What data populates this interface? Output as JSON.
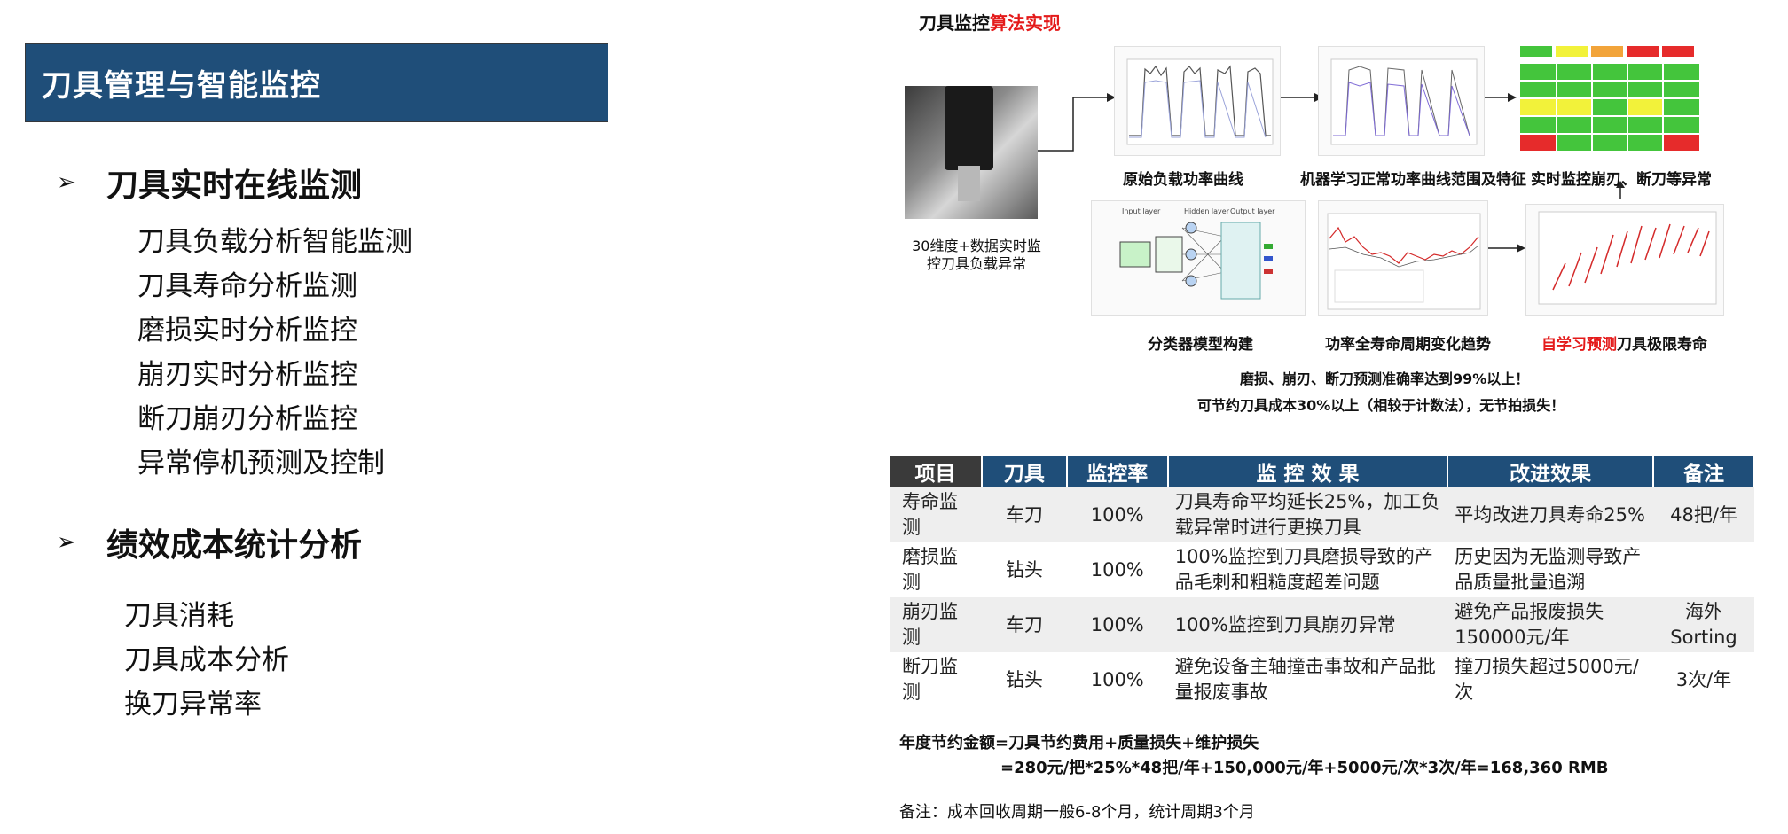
{
  "left": {
    "title": "刀具管理与智能监控",
    "section1": {
      "heading": "刀具实时在线监测",
      "items": [
        "刀具负载分析智能监测",
        "刀具寿命分析监测",
        "磨损实时分析监控",
        "崩刃实时分析监控",
        "断刀崩刃分析监控",
        "异常停机预测及控制"
      ]
    },
    "section2": {
      "heading": "绩效成本统计分析",
      "items": [
        "刀具消耗",
        "刀具成本分析",
        "换刀异常率"
      ]
    }
  },
  "figure": {
    "title_black": "刀具监控",
    "title_red": "算法实现",
    "machine_caption_l1": "30维度+数据实时监",
    "machine_caption_l2": "控刀具负载异常",
    "cap_raw": "原始负载功率曲线",
    "cap_ml": "机器学习正常功率曲线范围及特征",
    "cap_alert": "实时监控崩刃、断刀等异常",
    "cap_classifier": "分类器模型构建",
    "cap_trend": "功率全寿命周期变化趋势",
    "cap_life_red": "自学习预测",
    "cap_life_black": "刀具极限寿命",
    "nn_input": "Input layer",
    "nn_hidden": "Hidden layer",
    "nn_output": "Output layer",
    "summary_l1": "磨损、崩刃、断刀预测准确率达到99%以上！",
    "summary_l2": "可节约刀具成本30%以上（相较于计数法），无节拍损失！"
  },
  "table": {
    "headers": [
      "项目",
      "刀具",
      "监控率",
      "监 控 效 果",
      "改进效果",
      "备注"
    ],
    "rows": [
      [
        "寿命监测",
        "车刀",
        "100%",
        "刀具寿命平均延长25%，加工负载异常时进行更换刀具",
        "平均改进刀具寿命25%",
        "48把/年"
      ],
      [
        "磨损监测",
        "钻头",
        "100%",
        "100%监控到刀具磨损导致的产品毛刺和粗糙度超差问题",
        "历史因为无监测导致产品质量批量追溯",
        ""
      ],
      [
        "崩刃监测",
        "车刀",
        "100%",
        "100%监控到刀具崩刃异常",
        "避免产品报废损失150000元/年",
        "海外Sorting"
      ],
      [
        "断刀监测",
        "钻头",
        "100%",
        "避免设备主轴撞击事故和产品批量报废事故",
        "撞刀损失超过5000元/次",
        "3次/年"
      ]
    ]
  },
  "savings": {
    "line1": "年度节约金额=刀具节约费用+质量损失+维护损失",
    "line2": "=280元/把*25%*48把/年+150,000元/年+5000元/次*3次/年=168,360 RMB",
    "remark": "备注：成本回收周期一般6-8个月，统计周期3个月"
  },
  "colors": {
    "title_bg": "#1f4e79",
    "accent_red": "#e41a1a",
    "header_dark": "#3a3a3a"
  }
}
